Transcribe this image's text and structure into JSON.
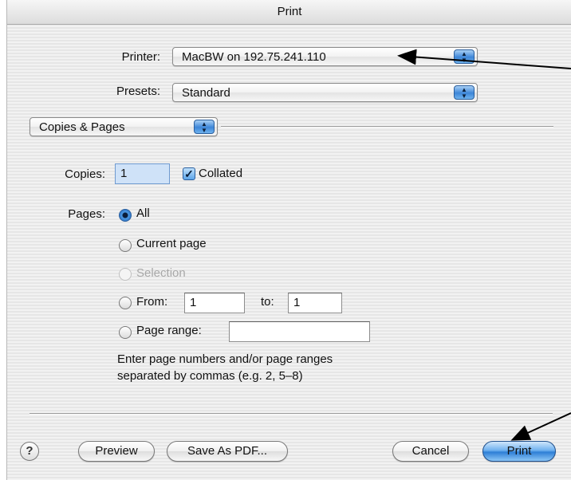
{
  "window": {
    "title": "Print"
  },
  "printer": {
    "label": "Printer:",
    "value": "MacBW on 192.75.241.110"
  },
  "presets": {
    "label": "Presets:",
    "value": "Standard"
  },
  "panel": {
    "value": "Copies & Pages"
  },
  "copies": {
    "label": "Copies:",
    "value": "1",
    "collated_label": "Collated",
    "collated_checked": true
  },
  "pages": {
    "label": "Pages:",
    "selected": "All",
    "options": [
      "All",
      "Current page",
      "Selection",
      "From:",
      "Page range:"
    ],
    "from_value": "1",
    "to_label": "to:",
    "to_value": "1",
    "range_value": "",
    "hint_line1": "Enter page numbers and/or page ranges",
    "hint_line2": "separated by commas (e.g. 2, 5–8)"
  },
  "buttons": {
    "help": "?",
    "preview": "Preview",
    "save_pdf": "Save As PDF...",
    "cancel": "Cancel",
    "print": "Print"
  },
  "icons": {
    "stepper": "up-down-arrows-icon",
    "checkbox": "checkmark-icon",
    "annotation": "arrow-annotation-icon"
  }
}
